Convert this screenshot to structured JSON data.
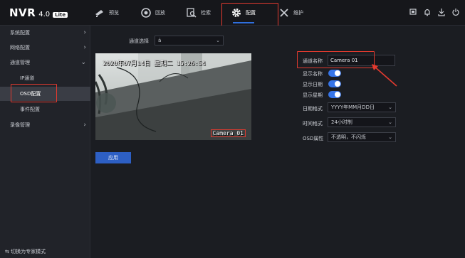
{
  "app": {
    "logo": "NVR",
    "version": "4.0",
    "edition": "Lite"
  },
  "nav": [
    {
      "label": "预览",
      "icon": "camera-icon"
    },
    {
      "label": "回放",
      "icon": "playback-icon"
    },
    {
      "label": "检索",
      "icon": "search-icon"
    },
    {
      "label": "配置",
      "icon": "gear-icon",
      "active": true
    },
    {
      "label": "维护",
      "icon": "wrench-icon"
    }
  ],
  "top_icons": [
    "screen-icon",
    "bell-icon",
    "download-icon",
    "power-icon"
  ],
  "sidebar": {
    "items": [
      {
        "label": "系统配置",
        "chevron": "›"
      },
      {
        "label": "网络配置",
        "chevron": "›"
      },
      {
        "label": "通道管理",
        "chevron": "⌄"
      },
      {
        "label": "IP通道"
      },
      {
        "label": "OSD配置",
        "selected": true
      },
      {
        "label": "事件配置"
      },
      {
        "label": "录像管理",
        "chevron": "›"
      }
    ],
    "bottom": "⇆ 切换为专家模式"
  },
  "form": {
    "channel_select_label": "通道选择",
    "channel_select_value": "á",
    "channel_name_label": "通道名称",
    "channel_name_value": "Camera 01",
    "show_name_label": "显示名称",
    "show_date_label": "显示日期",
    "show_week_label": "显示星期",
    "date_format_label": "日期格式",
    "date_format_value": "YYYY年MM月DD日",
    "time_format_label": "时间格式",
    "time_format_value": "24小时制",
    "osd_attr_label": "OSD属性",
    "osd_attr_value": "不透明，不闪烁",
    "apply_label": "应用"
  },
  "preview": {
    "osd_time": "2020年07月14日 星期二 15:26:54",
    "osd_name": "Camera 01"
  },
  "colors": {
    "accent": "#2f6fde",
    "highlight": "#e33a2f",
    "toggle": "#3574e8"
  }
}
